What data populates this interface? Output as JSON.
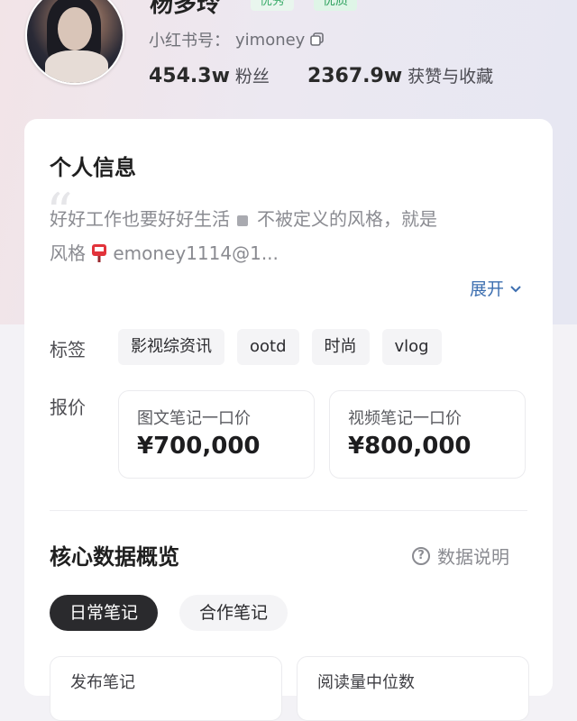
{
  "profile": {
    "name": "杨多玲",
    "badges": [
      "优秀",
      "优质"
    ],
    "id_label": "小红书号：",
    "id_value": "yimoney",
    "followers_value": "454.3w",
    "followers_label": "粉丝",
    "likes_value": "2367.9w",
    "likes_label": "获赞与收藏"
  },
  "info": {
    "title": "个人信息",
    "bio_line1": "好好工作也要好好生活",
    "bio_line1b": "不被定义的风格，就是",
    "bio_line2": "风格",
    "bio_email": "emoney1114@1...",
    "expand": "展开",
    "tags_label": "标签",
    "tags": [
      "影视综资讯",
      "ootd",
      "时尚",
      "vlog"
    ],
    "price_label": "报价",
    "prices": [
      {
        "label": "图文笔记一口价",
        "value": "¥700,000"
      },
      {
        "label": "视频笔记一口价",
        "value": "¥800,000"
      }
    ]
  },
  "core": {
    "title": "核心数据概览",
    "help": "数据说明",
    "tabs": [
      "日常笔记",
      "合作笔记"
    ],
    "stats": [
      "发布笔记",
      "阅读量中位数"
    ]
  },
  "colors": {
    "accent_link": "#3d6fb0",
    "badge_green": "#3fae6e",
    "pill_active": "#2a2a2d"
  },
  "icons": [
    "copy-icon",
    "mailbox-icon",
    "chevron-down-icon",
    "help-circle-icon"
  ]
}
